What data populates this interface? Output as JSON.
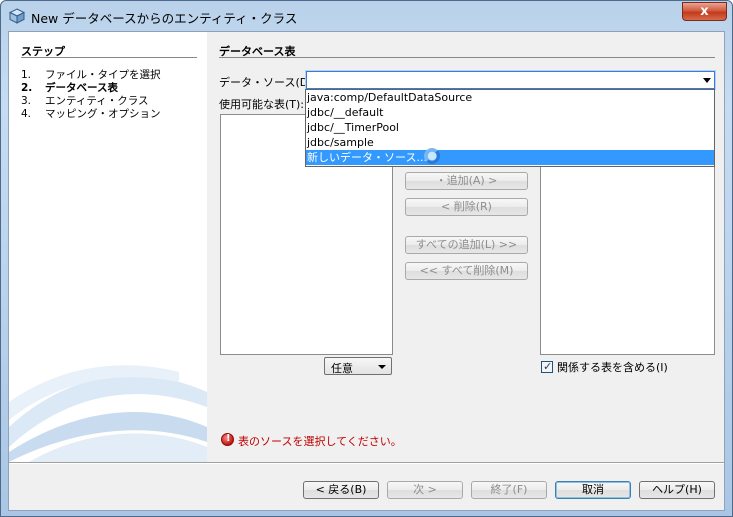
{
  "window": {
    "title": "New データベースからのエンティティ・クラス",
    "close_label": "x"
  },
  "steps": {
    "title": "ステップ",
    "items": [
      {
        "num": "1.",
        "label": "ファイル・タイプを選択"
      },
      {
        "num": "2.",
        "label": "データベース表"
      },
      {
        "num": "3.",
        "label": "エンティティ・クラス"
      },
      {
        "num": "4.",
        "label": "マッピング・オプション"
      }
    ]
  },
  "panel": {
    "title": "データベース表",
    "datasource_label": "データ・ソース(D):",
    "datasource_value": "",
    "available_label": "使用可能な表(T):",
    "filter_value": "任意",
    "include_related_label": "関係する表を含める(I)",
    "include_related_checked": true,
    "error_message": "表のソースを選択してください。"
  },
  "transfer_buttons": {
    "add": "・追加(A) >",
    "remove": "< 削除(R)",
    "add_all": "すべての追加(L) >>",
    "remove_all": "<< すべて削除(M)"
  },
  "dropdown": {
    "options": [
      "java:comp/DefaultDataSource",
      "jdbc/__default",
      "jdbc/__TimerPool",
      "jdbc/sample",
      "新しいデータ・ソース..."
    ],
    "selected_index": 4
  },
  "footer": {
    "back": "< 戻る(B)",
    "next": "次 >",
    "finish": "終了(F)",
    "cancel": "取消",
    "help": "ヘルプ(H)"
  }
}
